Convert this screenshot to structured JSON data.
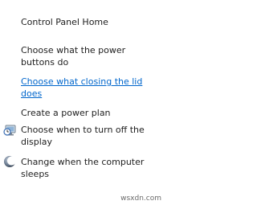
{
  "links": {
    "control_panel_home": "Control Panel Home",
    "power_buttons_line1": "Choose what the power",
    "power_buttons_line2": "buttons do",
    "closing_lid_line1": "Choose what closing the lid",
    "closing_lid_line2": "does",
    "create_power_plan": "Create a power plan",
    "turn_off_display_line1": "Choose when to turn off the",
    "turn_off_display_line2": "display",
    "computer_sleeps_line1": "Change when the computer",
    "computer_sleeps_line2": "sleeps"
  },
  "icons": {
    "display": "monitor-clock-icon",
    "sleep": "moon-icon"
  },
  "colors": {
    "text": "#1e1e1e",
    "hover_link": "#0066cc",
    "background": "#ffffff"
  },
  "watermark": "wsxdn.com"
}
